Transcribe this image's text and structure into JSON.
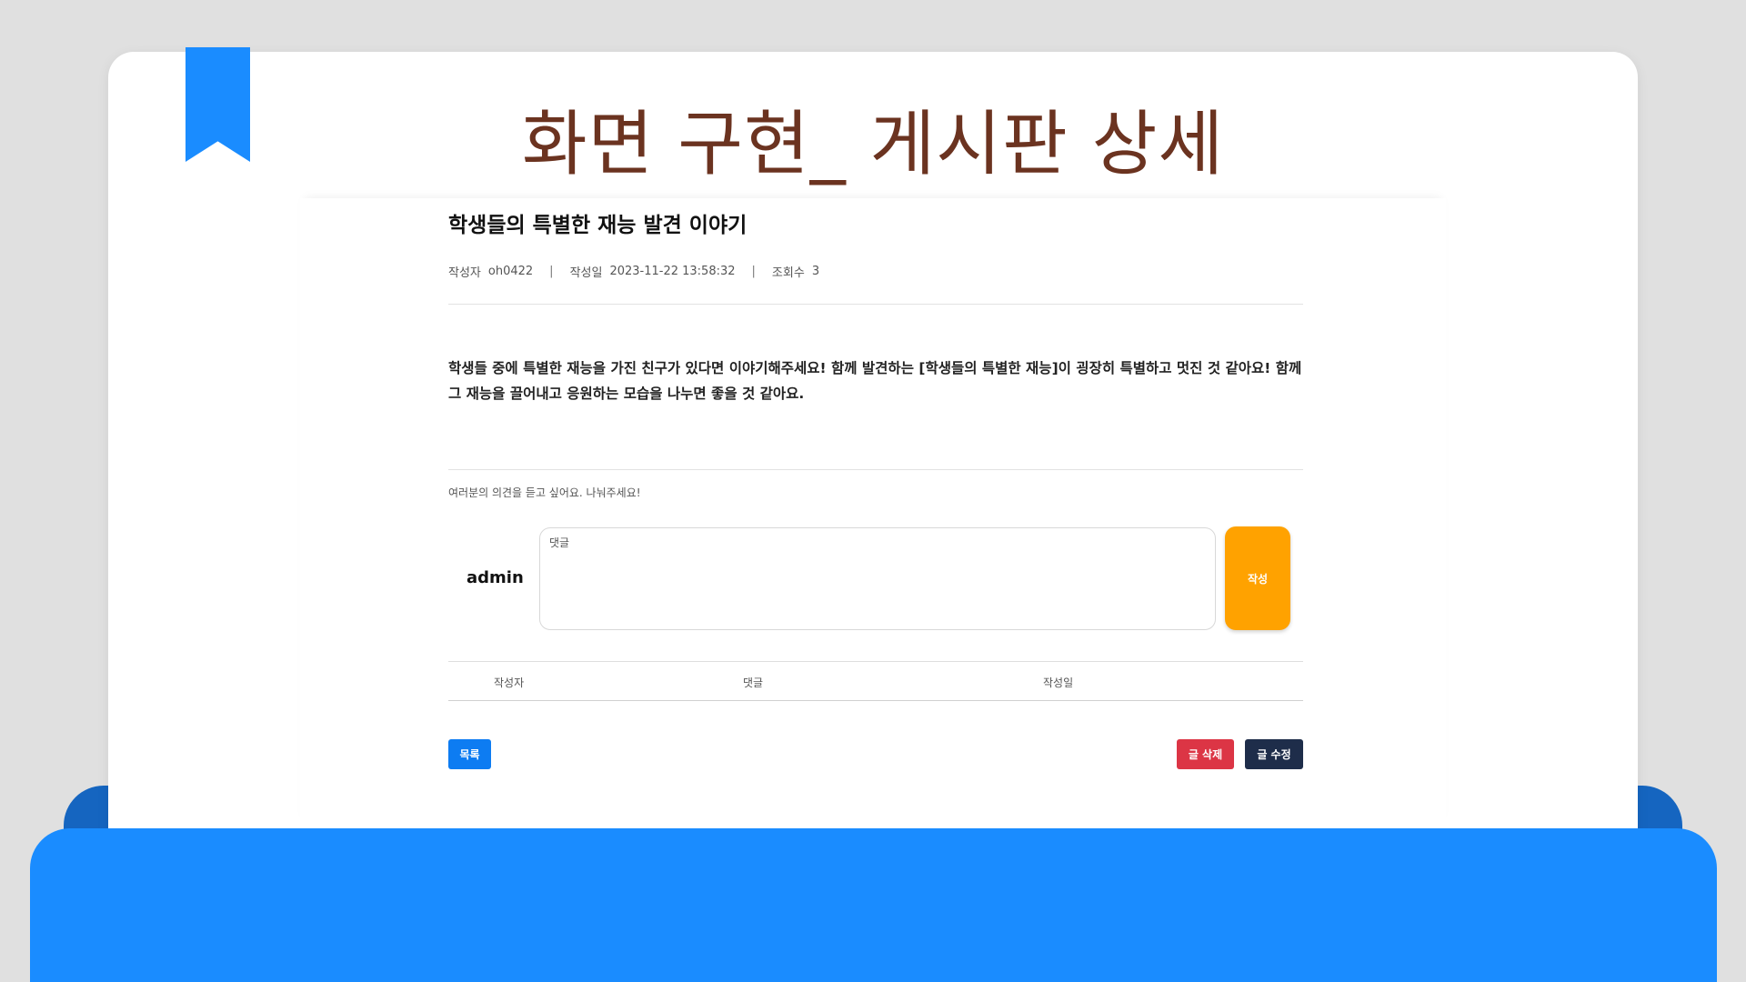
{
  "slide": {
    "title": "화면 구현_ 게시판 상세"
  },
  "post": {
    "title": "학생들의 특별한 재능 발견 이야기",
    "author_label": "작성자",
    "author": "oh0422",
    "date_label": "작성일",
    "date": "2023-11-22 13:58:32",
    "views_label": "조회수",
    "views": "3",
    "separator": "|",
    "content": "학생들 중에 특별한 재능을 가진 친구가 있다면 이야기해주세요! 함께 발견하는 [학생들의 특별한 재능]이 굉장히 특별하고 멋진 것 같아요! 함께 그 재능을 끌어내고 응원하는 모습을 나누면 좋을 것 같아요."
  },
  "comments": {
    "prompt": "여러분의 의견을 듣고 싶어요. 나눠주세요!",
    "current_user": "admin",
    "input_placeholder": "댓글",
    "input_value": "",
    "submit_label": "작성",
    "columns": [
      "작성자",
      "댓글",
      "작성일"
    ]
  },
  "actions": {
    "list_label": "목록",
    "delete_label": "글 삭제",
    "edit_label": "글 수정"
  },
  "colors": {
    "title_brown": "#6b3320",
    "accent_blue": "#1a8cff",
    "submit_orange": "#ffa200",
    "delete_red": "#dc3545",
    "edit_navy": "#1e2d4a"
  }
}
